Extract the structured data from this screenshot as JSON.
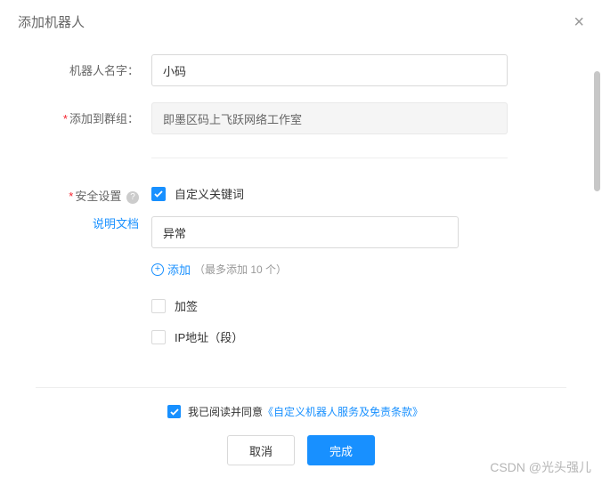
{
  "header": {
    "title": "添加机器人"
  },
  "form": {
    "name_label": "机器人名字：",
    "name_value": "小码",
    "group_label": "添加到群组：",
    "group_value": "即墨区码上飞跃网络工作室",
    "security_label": "安全设置",
    "doc_link": "说明文档",
    "keyword_checkbox_label": "自定义关键词",
    "keyword_value": "异常",
    "add_label": "添加",
    "add_hint": "（最多添加 10 个）",
    "sign_label": "加签",
    "ip_label": "IP地址（段）"
  },
  "footer": {
    "agree_prefix": "我已阅读并同意",
    "agree_link": "《自定义机器人服务及免责条款》",
    "cancel": "取消",
    "confirm": "完成"
  },
  "watermark": "CSDN @光头强儿"
}
